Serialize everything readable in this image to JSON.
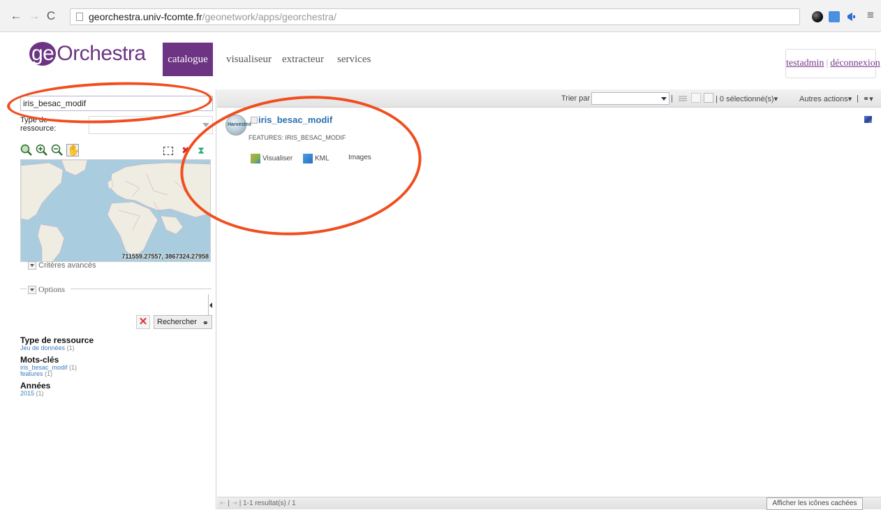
{
  "browser": {
    "url_host": "georchestra.univ-fcomte.fr",
    "url_path": "/geonetwork/apps/georchestra/",
    "back_icon": "back-arrow-icon",
    "forward_icon": "forward-arrow-icon",
    "reload_icon": "reload-icon",
    "menu_icon": "hamburger-menu-icon"
  },
  "header": {
    "logo_ge": "ge",
    "logo_rest": "Orchestra",
    "nav": {
      "catalogue": "catalogue",
      "visualiseur": "visualiseur",
      "extracteur": "extracteur",
      "services": "services"
    },
    "user": "testadmin",
    "logout": "déconnexion",
    "separator": "|",
    "brand_color": "#6c3482"
  },
  "left": {
    "search_value": "iris_besac_modif",
    "type_label": "Type de ressource:",
    "map_coords": "711559.27557, 3867324.27958",
    "advanced_criteria": "Critères avancés",
    "options": "Options",
    "search_button": "Rechercher",
    "facets": {
      "type_title": "Type de ressource",
      "type_item": "Jeu de données",
      "type_count": "(1)",
      "keywords_title": "Mots-clés",
      "kw1": "iris_besac_modif",
      "kw1_count": "(1)",
      "kw2": "features",
      "kw2_count": "(1)",
      "years_title": "Années",
      "year1": "2015",
      "year1_count": "(1)"
    }
  },
  "results": {
    "sort_label": "Trier par",
    "selected": "| 0 sélectionné(s)▾",
    "other_actions": "Autres actions▾",
    "item": {
      "thumb_label": "Harvested",
      "title": "iris_besac_modif",
      "subtitle": "FEATURES: IRIS_BESAC_MODIF",
      "link_view": "Visualiser",
      "link_kml": "KML",
      "link_images": "Images"
    },
    "pager": "| 1-1 resultat(s) / 1",
    "hidden_icons": "Afficher les icônes cachées"
  },
  "annotation_color": "#f04e1f"
}
